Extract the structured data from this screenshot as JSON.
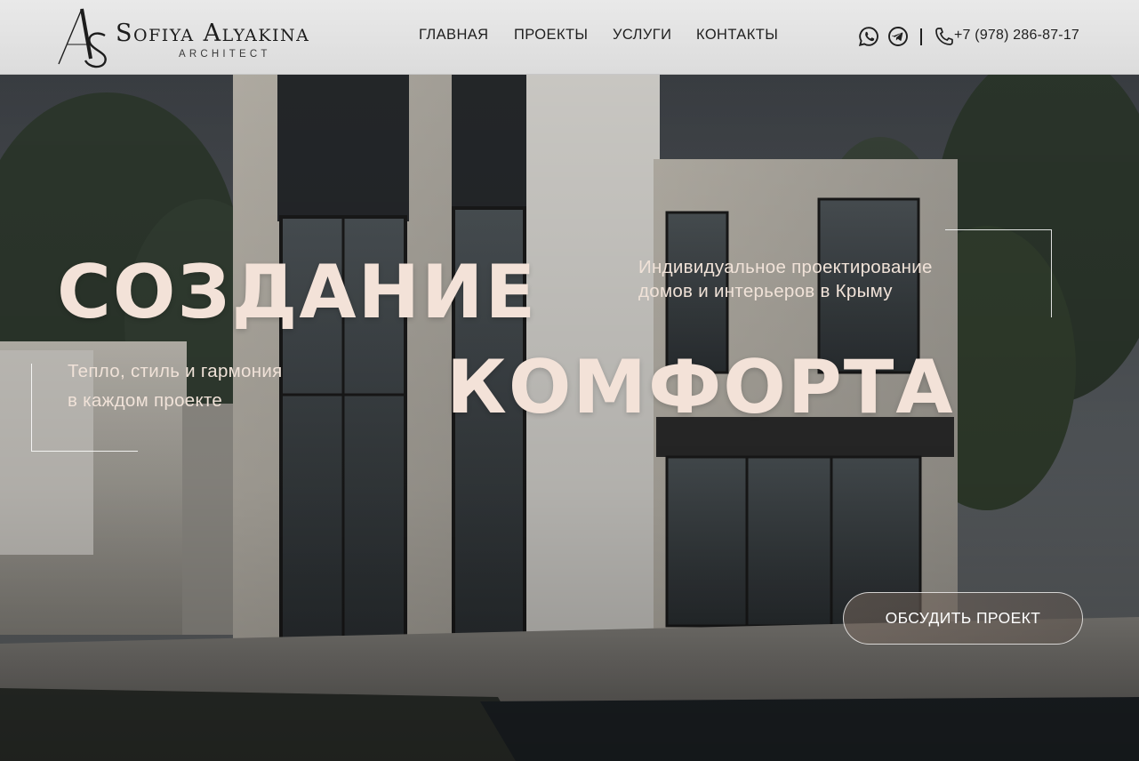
{
  "header": {
    "brand_name": "Sofiya Alyakina",
    "brand_sub": "ARCHITECT",
    "nav": [
      {
        "label": "ГЛАВНАЯ"
      },
      {
        "label": "ПРОЕКТЫ"
      },
      {
        "label": "УСЛУГИ"
      },
      {
        "label": "КОНТАКТЫ"
      }
    ],
    "contacts": {
      "whatsapp_icon": "whatsapp-icon",
      "telegram_icon": "telegram-icon",
      "phone_icon": "phone-icon",
      "phone": "+7 (978) 286-87-17"
    }
  },
  "hero": {
    "headline_line1": "СОЗДАНИЕ",
    "headline_line2": "КОМФОРТА",
    "tagline_right": [
      "Индивидуальное проектирование",
      "домов и интерьеров в Крыму"
    ],
    "tagline_left": [
      "Тепло, стиль и гармония",
      "в каждом проекте"
    ],
    "cta_label": "ОБСУДИТЬ ПРОЕКТ"
  },
  "colors": {
    "header_bg": "#e5e5e5",
    "headline": "#f3e2d8",
    "text_dark": "#1f1f1f"
  }
}
